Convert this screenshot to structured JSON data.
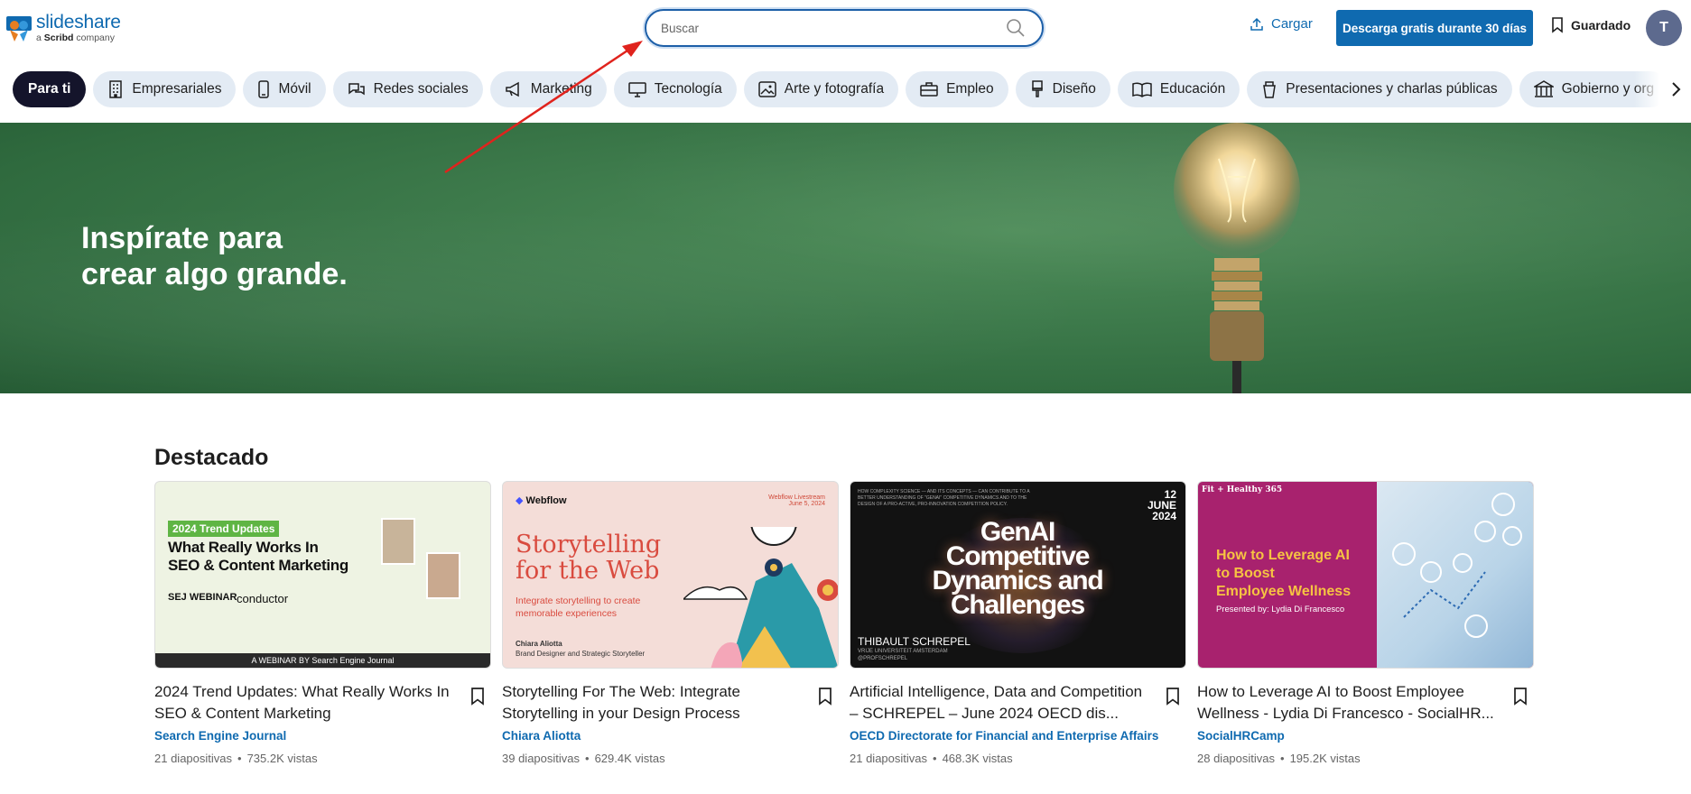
{
  "header": {
    "logo_name": "slideshare",
    "logo_sub_prefix": "a ",
    "logo_sub_brand": "Scribd",
    "logo_sub_suffix": " company",
    "search_placeholder": "Buscar",
    "upload_label": "Cargar",
    "trial_button": "Descarga gratis durante 30 días",
    "saved_label": "Guardado",
    "avatar_initial": "T"
  },
  "categories": [
    {
      "label": "Para ti",
      "icon": "none",
      "active": true
    },
    {
      "label": "Empresariales",
      "icon": "building-icon"
    },
    {
      "label": "Móvil",
      "icon": "phone-icon"
    },
    {
      "label": "Redes sociales",
      "icon": "chat-bubbles-icon"
    },
    {
      "label": "Marketing",
      "icon": "megaphone-icon"
    },
    {
      "label": "Tecnología",
      "icon": "monitor-icon"
    },
    {
      "label": "Arte y fotografía",
      "icon": "image-icon"
    },
    {
      "label": "Empleo",
      "icon": "briefcase-icon"
    },
    {
      "label": "Diseño",
      "icon": "paintbrush-icon"
    },
    {
      "label": "Educación",
      "icon": "book-icon"
    },
    {
      "label": "Presentaciones y charlas públicas",
      "icon": "podium-icon"
    },
    {
      "label": "Gobierno y org",
      "icon": "government-icon"
    }
  ],
  "hero": {
    "line1": "Inspírate para",
    "line2": "crear algo grande."
  },
  "featured": {
    "title": "Destacado",
    "cards": [
      {
        "title": "2024 Trend Updates: What Really Works In SEO & Content Marketing",
        "author": "Search Engine Journal",
        "slides": "21 diapositivas",
        "views": "735.2K vistas",
        "thumb": {
          "tag": "2024 Trend Updates",
          "heading_line1": "What Really Works In",
          "heading_line2": "SEO & Content Marketing",
          "left_logo": "SEJ WEBINAR",
          "right_logo": "conductor",
          "footer": "A WEBINAR BY Search Engine Journal"
        }
      },
      {
        "title": "Storytelling For The Web: Integrate Storytelling in your Design Process",
        "author": "Chiara Aliotta",
        "slides": "39 diapositivas",
        "views": "629.4K vistas",
        "thumb": {
          "brand": "Webflow",
          "date_line1": "Webflow Livestream",
          "date_line2": "June 5, 2024",
          "heading_line1": "Storytelling",
          "heading_line2": "for the Web",
          "sub_line1": "Integrate storytelling to create",
          "sub_line2": "memorable experiences",
          "author_name": "Chiara Aliotta",
          "author_role": "Brand Designer and Strategic Storyteller"
        }
      },
      {
        "title": "Artificial Intelligence, Data and Competition – SCHREPEL – June 2024 OECD dis...",
        "author": "OECD Directorate for Financial and Enterprise Affairs",
        "slides": "21 diapositivas",
        "views": "468.3K vistas",
        "thumb": {
          "top_text": "HOW COMPLEXITY SCIENCE — AND ITS CONCEPTS — CAN CONTRIBUTE TO A BETTER UNDERSTANDING OF \"GENAI\" COMPETITIVE DYNAMICS AND TO THE DESIGN OF A PRO-ACTIVE, PRO-INNOVATION COMPETITION POLICY.",
          "date_line1": "12",
          "date_line2": "JUNE",
          "date_line3": "2024",
          "heading_line1": "GenAI",
          "heading_line2": "Competitive",
          "heading_line3": "Dynamics and",
          "heading_line4": "Challenges",
          "name": "THIBAULT SCHREPEL",
          "affil1": "VRIJE UNIVERSITEIT AMSTERDAM",
          "affil2": "@PROFSCHREPEL"
        }
      },
      {
        "title": "How to Leverage AI to Boost Employee Wellness - Lydia Di Francesco - SocialHR...",
        "author": "SocialHRCamp",
        "slides": "28 diapositivas",
        "views": "195.2K vistas",
        "thumb": {
          "brand": "Fit + Healthy 365",
          "heading_line1": "How to Leverage AI",
          "heading_line2": "to Boost",
          "heading_line3": "Employee Wellness",
          "presenter": "Presented by: Lydia Di Francesco"
        }
      }
    ]
  },
  "colors": {
    "brand_blue": "#0f6ab0",
    "chip_bg": "#e3ebf4",
    "chip_active_bg": "#14142b",
    "hero_green": "#3d7a4b",
    "annotation_arrow": "#e0231d"
  }
}
